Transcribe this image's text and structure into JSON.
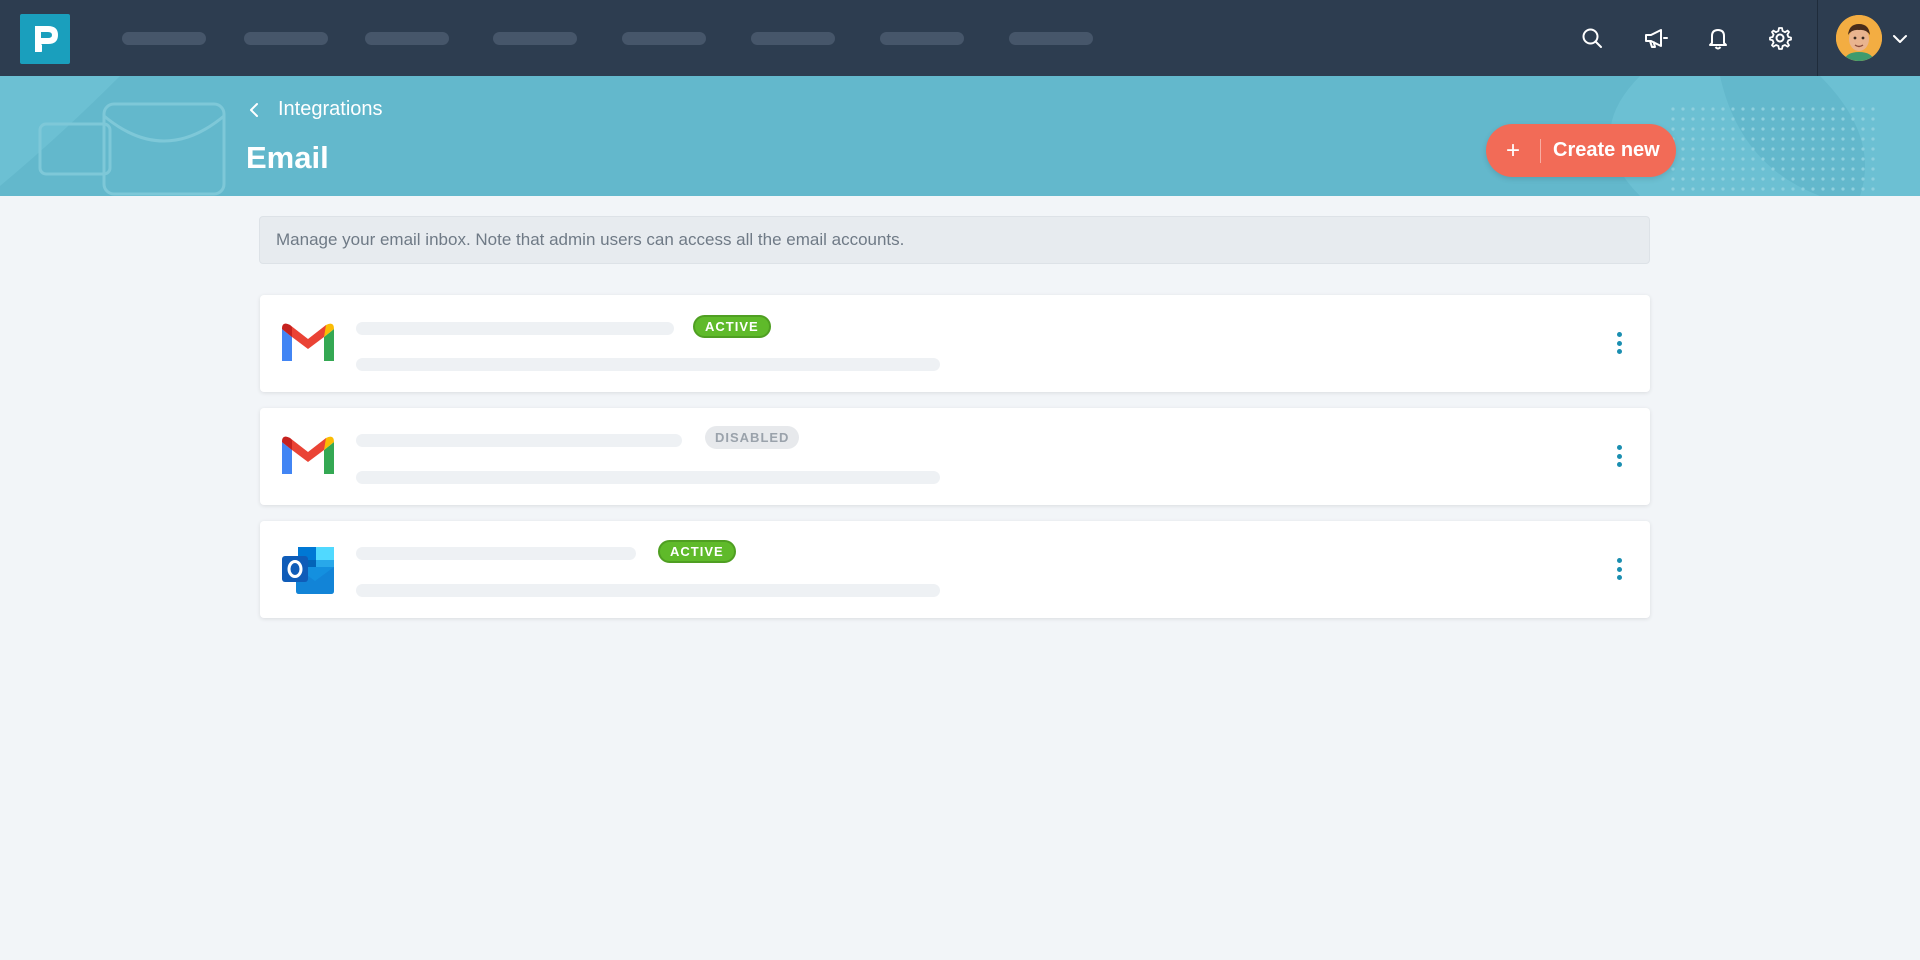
{
  "topbar": {
    "logo_icon": "app-logo-icon",
    "nav_placeholders": [
      1,
      2,
      3,
      4,
      5,
      6,
      7,
      8
    ],
    "icons": [
      "search-icon",
      "megaphone-icon",
      "bell-icon",
      "gear-icon"
    ],
    "avatar": "user-avatar",
    "menu_icon": "chevron-down-icon"
  },
  "header": {
    "breadcrumb": "Integrations",
    "title": "Email",
    "create_button_label": "Create new",
    "create_button_icon": "plus-icon"
  },
  "note": "Manage your email inbox. Note that admin users can access all the email accounts.",
  "accounts": [
    {
      "provider": "gmail",
      "status": "ACTIVE"
    },
    {
      "provider": "gmail",
      "status": "DISABLED"
    },
    {
      "provider": "outlook",
      "status": "ACTIVE"
    }
  ],
  "colors": {
    "topbar": "#2d3d50",
    "banner": "#63b8cc",
    "accent_button": "#f26b57",
    "active_badge": "#5fba2a",
    "kebab": "#1a8eb0"
  }
}
